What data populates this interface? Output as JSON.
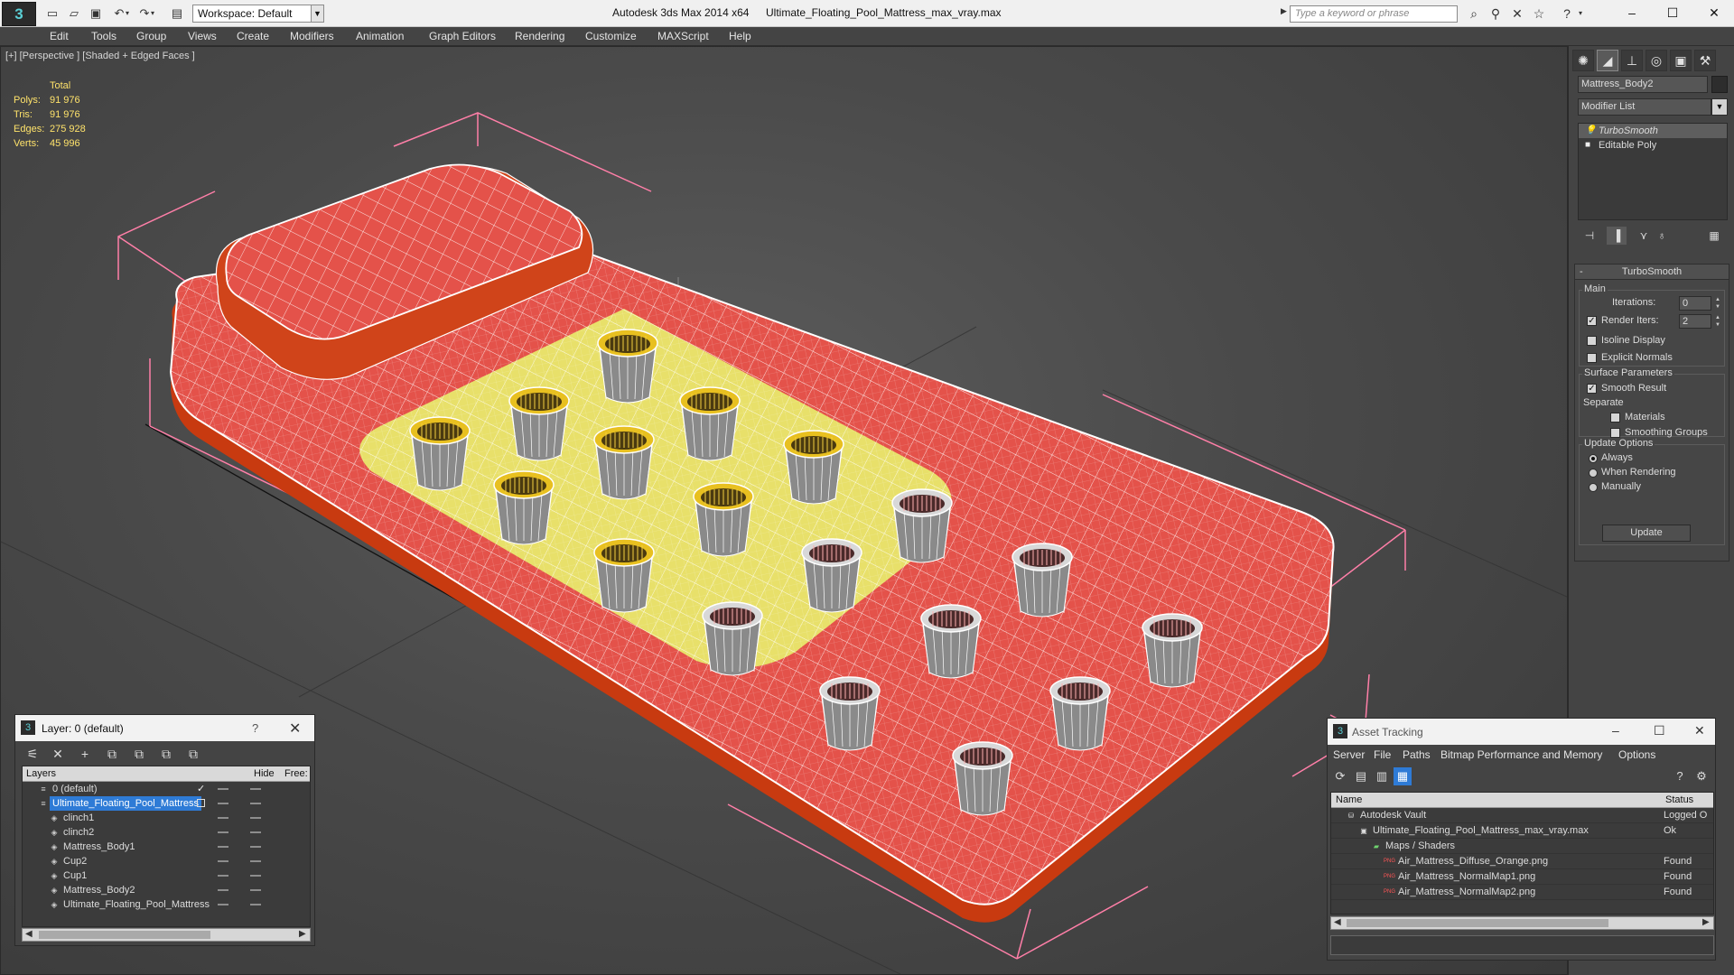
{
  "window": {
    "app_logo": "3",
    "app_title": "Autodesk 3ds Max  2014 x64",
    "file_title": "Ultimate_Floating_Pool_Mattress_max_vray.max",
    "workspace": "Workspace: Default",
    "search_placeholder": "Type a keyword or phrase",
    "controls": {
      "minimize": "–",
      "maximize": "☐",
      "close": "✕"
    }
  },
  "menu": [
    "Edit",
    "Tools",
    "Group",
    "Views",
    "Create",
    "Modifiers",
    "Animation",
    "Graph Editors",
    "Rendering",
    "Customize",
    "MAXScript",
    "Help"
  ],
  "viewport": {
    "label": "[+] [Perspective ] [Shaded + Edged Faces ]",
    "stats": {
      "header": "Total",
      "rows": [
        {
          "key": "Polys:",
          "value": "91 976"
        },
        {
          "key": "Tris:",
          "value": "91 976"
        },
        {
          "key": "Edges:",
          "value": "275 928"
        },
        {
          "key": "Verts:",
          "value": "45 996"
        }
      ]
    },
    "colors": {
      "mattress_red": "#e4524a",
      "mattress_yellow": "#e8e06a",
      "pillow_orange": "#d0441a",
      "wire": "#ffffff",
      "bbox": "#ff7fa8",
      "cup_rim": "#e8c020"
    }
  },
  "command_panel": {
    "tab_icons": [
      "create-icon",
      "modify-icon",
      "hierarchy-icon",
      "motion-icon",
      "display-icon",
      "utilities-icon"
    ],
    "object_name": "Mattress_Body2",
    "modifier_list": "Modifier List",
    "stack": [
      "TurboSmooth",
      "Editable Poly"
    ],
    "rollout_title": "TurboSmooth",
    "main_group": "Main",
    "iterations_label": "Iterations:",
    "iterations_value": "0",
    "render_iters_label": "Render Iters:",
    "render_iters_value": "2",
    "isoline_label": "Isoline Display",
    "explicit_normals_label": "Explicit Normals",
    "surface_group": "Surface Parameters",
    "smooth_result_label": "Smooth Result",
    "separate_label": "Separate",
    "materials_label": "Materials",
    "smoothing_groups_label": "Smoothing Groups",
    "update_group": "Update Options",
    "always_label": "Always",
    "when_rendering_label": "When Rendering",
    "manually_label": "Manually",
    "update_button": "Update"
  },
  "layer_panel": {
    "title": "Layer: 0 (default)",
    "help": "?",
    "close": "✕",
    "columns": {
      "layers": "Layers",
      "hide": "Hide",
      "freeze": "Free:"
    },
    "rows": [
      {
        "name": "0 (default)",
        "indent": 1,
        "kind": "layer"
      },
      {
        "name": "Ultimate_Floating_Pool_Mattress",
        "indent": 1,
        "kind": "layer-selected"
      },
      {
        "name": "clinch1",
        "indent": 2,
        "kind": "object"
      },
      {
        "name": "clinch2",
        "indent": 2,
        "kind": "object"
      },
      {
        "name": "Mattress_Body1",
        "indent": 2,
        "kind": "object"
      },
      {
        "name": "Cup2",
        "indent": 2,
        "kind": "object"
      },
      {
        "name": "Cup1",
        "indent": 2,
        "kind": "object"
      },
      {
        "name": "Mattress_Body2",
        "indent": 2,
        "kind": "object"
      },
      {
        "name": "Ultimate_Floating_Pool_Mattress",
        "indent": 2,
        "kind": "object"
      }
    ]
  },
  "asset_panel": {
    "title": "Asset Tracking",
    "menu": [
      "Server",
      "File",
      "Paths",
      "Bitmap Performance and Memory",
      "Options"
    ],
    "columns": {
      "name": "Name",
      "status": "Status"
    },
    "rows": [
      {
        "name": "Autodesk Vault",
        "status": "Logged O",
        "indent": 0,
        "icon": "vault-icon"
      },
      {
        "name": "Ultimate_Floating_Pool_Mattress_max_vray.max",
        "status": "Ok",
        "indent": 1,
        "icon": "max-file-icon"
      },
      {
        "name": "Maps / Shaders",
        "status": "",
        "indent": 2,
        "icon": "maps-icon"
      },
      {
        "name": "Air_Mattress_Diffuse_Orange.png",
        "status": "Found",
        "indent": 3,
        "icon": "png-icon"
      },
      {
        "name": "Air_Mattress_NormalMap1.png",
        "status": "Found",
        "indent": 3,
        "icon": "png-icon"
      },
      {
        "name": "Air_Mattress_NormalMap2.png",
        "status": "Found",
        "indent": 3,
        "icon": "png-icon"
      }
    ]
  }
}
